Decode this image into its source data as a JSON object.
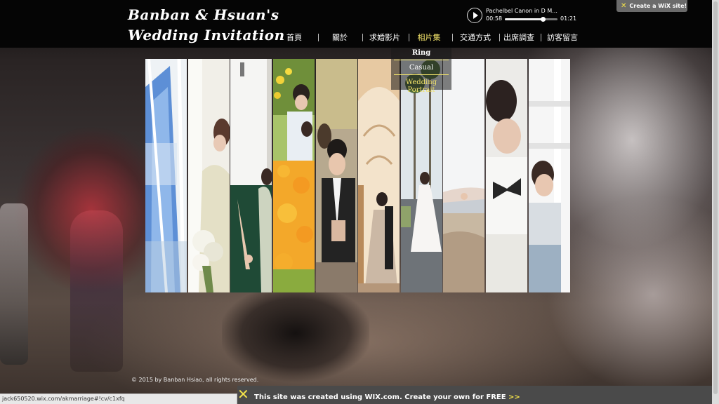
{
  "header": {
    "title_line1": "Banban & Hsuan's",
    "title_line2": "Wedding Invitation"
  },
  "player": {
    "track_title": "Pachelbel Canon in D M...",
    "current_time": "00:58",
    "total_time": "01:21",
    "progress_fraction": 0.72
  },
  "wix_create": {
    "label": "Create a WiX site!"
  },
  "nav": {
    "items": [
      {
        "label": "首頁"
      },
      {
        "label": "關於"
      },
      {
        "label": "求婚影片"
      },
      {
        "label": "相片集"
      },
      {
        "label": "交通方式"
      },
      {
        "label": "出席調查"
      },
      {
        "label": "訪客留言"
      }
    ],
    "active_index": 3
  },
  "dropdown": {
    "items": [
      "Ring",
      "Casual",
      "Wedding Portrait"
    ]
  },
  "gallery": {
    "strips": [
      {
        "scene": "window-sky"
      },
      {
        "scene": "bride-bouquet"
      },
      {
        "scene": "hands-green"
      },
      {
        "scene": "couple-flowers"
      },
      {
        "scene": "groom-portrait"
      },
      {
        "scene": "arch-kiss"
      },
      {
        "scene": "palms-bride"
      },
      {
        "scene": "beach-hands"
      },
      {
        "scene": "groom-bowtie"
      },
      {
        "scene": "window-couple"
      }
    ]
  },
  "footer": {
    "copyright": "© 2015 by Banban Hsiao, all rights reserved."
  },
  "status_bar": {
    "url": "jack650520.wix.com/akmarriage#!cv/c1xfq"
  },
  "wix_banner": {
    "text": "This site was created using WIX.com. Create your own for FREE",
    "arrows": ">>"
  },
  "colors": {
    "accent": "#f2e36a",
    "wix_yellow": "#f3e24a",
    "topbar": "#050505",
    "banner": "#4a4a4a"
  }
}
